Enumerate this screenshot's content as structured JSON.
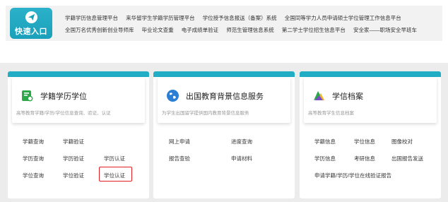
{
  "quick_entry": {
    "badge_label": "快速入口",
    "row1": [
      "学籍学历信息管理平台",
      "来华留学生学籍学历管理平台",
      "学位授予信息报送（备案）系统",
      "全国同等学力人员申请硕士学位管理工作信息平台"
    ],
    "row2": [
      "全国万名优秀创新创业导师库",
      "毕业论文查重",
      "电子成绩单验证",
      "师范生管理信息系统",
      "第二学士学位招生信息平台",
      "安全家——职场安全早班车"
    ]
  },
  "cards": [
    {
      "title": "学籍学历学位",
      "subtitle": "高等教育学籍/学历/学位信息查询、验证、认证",
      "links": [
        "学籍查询",
        "学籍验证",
        "学历查询",
        "学历验证",
        "学历认证",
        "学位查询",
        "学位验证",
        "学位认证"
      ]
    },
    {
      "title": "出国教育背景信息服务",
      "subtitle": "为学生出国留学提供国内教育背景信息服务",
      "links": [
        "网上申请",
        "进度查询",
        "报告查验",
        "申请材料"
      ]
    },
    {
      "title": "学信档案",
      "subtitle": "高等教育学生信息档案",
      "links": [
        "学籍信息",
        "学位信息",
        "图像校对",
        "学历信息",
        "考研信息",
        "出国报告发送",
        "申请学籍/学历/学位在线验证报告"
      ]
    }
  ],
  "colors": {
    "accent": "#21aec5",
    "highlight": "#e02020",
    "section_bg": "#ececec"
  }
}
